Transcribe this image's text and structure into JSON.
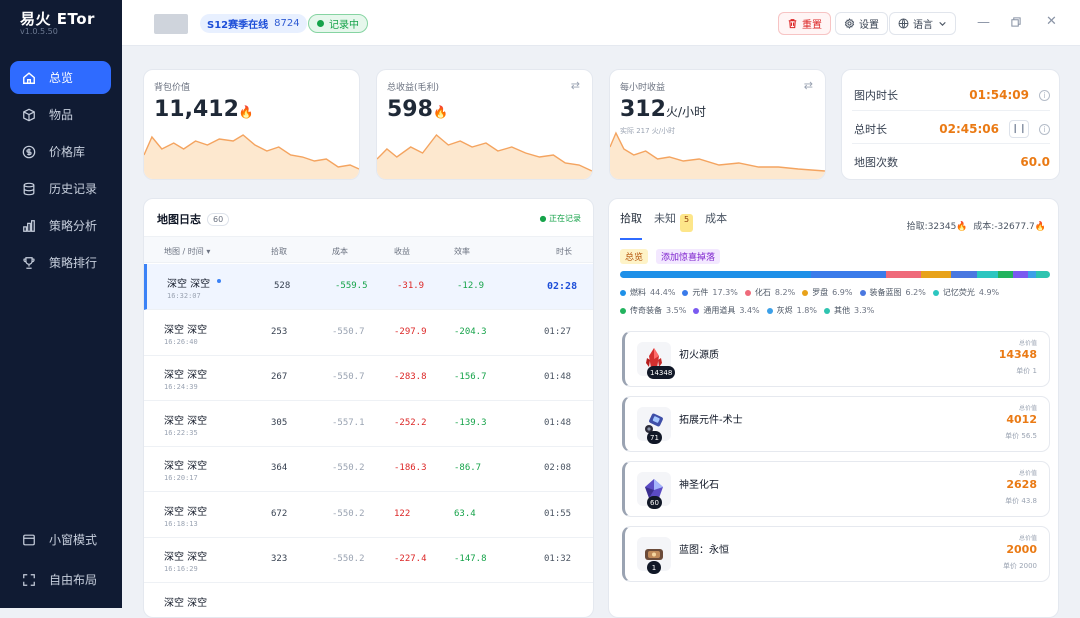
{
  "app": {
    "title": "易火 ETor",
    "version": "v1.0.5.50"
  },
  "nav": [
    {
      "label": "总览",
      "icon": "home-icon",
      "active": true
    },
    {
      "label": "物品",
      "icon": "box-icon"
    },
    {
      "label": "价格库",
      "icon": "dollar-icon"
    },
    {
      "label": "历史记录",
      "icon": "database-icon"
    },
    {
      "label": "策略分析",
      "icon": "bar-chart-icon"
    },
    {
      "label": "策略排行",
      "icon": "trophy-icon"
    }
  ],
  "nav_bottom": [
    {
      "label": "小窗模式",
      "icon": "window-icon"
    },
    {
      "label": "自由布局",
      "icon": "expand-icon"
    }
  ],
  "topbar": {
    "season_label": "S12赛季在线",
    "season_count": "8724",
    "recording": "记录中",
    "reset": "重置",
    "settings": "设置",
    "language": "语言"
  },
  "cards": {
    "bag": {
      "title": "背包价值",
      "value": "11,412"
    },
    "profit": {
      "title": "总收益(毛利)",
      "value": "598"
    },
    "hourly": {
      "title": "每小时收益",
      "value": "312",
      "unit": "火/小时",
      "actual": "实际 217 火/小时"
    }
  },
  "timers": [
    {
      "label": "图内时长",
      "value": "01:54:09"
    },
    {
      "label": "总时长",
      "value": "02:45:06"
    },
    {
      "label": "地图次数",
      "value": "60.0"
    }
  ],
  "log": {
    "title": "地图日志",
    "count": "60",
    "status": "正在记录",
    "headers": [
      "地图 / 时间",
      "拾取",
      "成本",
      "收益",
      "效率",
      "时长"
    ],
    "rows": [
      {
        "name": "深空 深空",
        "time": "16:32:07",
        "pick": "528",
        "cost": "-559.5",
        "profit": "-31.9",
        "eff": "-12.9",
        "dur": "02:28"
      },
      {
        "name": "深空 深空",
        "time": "16:26:40",
        "pick": "253",
        "cost": "-550.7",
        "profit": "-297.9",
        "eff": "-204.3",
        "dur": "01:27"
      },
      {
        "name": "深空 深空",
        "time": "16:24:39",
        "pick": "267",
        "cost": "-550.7",
        "profit": "-283.8",
        "eff": "-156.7",
        "dur": "01:48"
      },
      {
        "name": "深空 深空",
        "time": "16:22:35",
        "pick": "305",
        "cost": "-557.1",
        "profit": "-252.2",
        "eff": "-139.3",
        "dur": "01:48"
      },
      {
        "name": "深空 深空",
        "time": "16:20:17",
        "pick": "364",
        "cost": "-550.2",
        "profit": "-186.3",
        "eff": "-86.7",
        "dur": "02:08"
      },
      {
        "name": "深空 深空",
        "time": "16:18:13",
        "pick": "672",
        "cost": "-550.2",
        "profit": "122",
        "eff": "63.4",
        "dur": "01:55"
      },
      {
        "name": "深空 深空",
        "time": "16:16:29",
        "pick": "323",
        "cost": "-550.2",
        "profit": "-227.4",
        "eff": "-147.8",
        "dur": "01:32"
      },
      {
        "name": "深空 深空",
        "time": "",
        "pick": "",
        "cost": "",
        "profit": "",
        "eff": "",
        "dur": ""
      }
    ]
  },
  "loot": {
    "tabs": [
      "拾取",
      "未知",
      "成本"
    ],
    "unknown_badge": "5",
    "pickup_total": "拾取:32345",
    "cost_total": "成本:-32677.7",
    "chips": [
      "总览",
      "添加惊喜掉落"
    ],
    "categories": [
      {
        "name": "燃料",
        "pct": "44.4%",
        "color": "#1e90e8"
      },
      {
        "name": "元件",
        "pct": "17.3%",
        "color": "#3a7bea"
      },
      {
        "name": "化石",
        "pct": "8.2%",
        "color": "#ef6a7a"
      },
      {
        "name": "罗盘",
        "pct": "6.9%",
        "color": "#e8a21a"
      },
      {
        "name": "装备蓝图",
        "pct": "6.2%",
        "color": "#4a78e0"
      },
      {
        "name": "记忆荧光",
        "pct": "4.9%",
        "color": "#2cc6c0"
      },
      {
        "name": "传奇装备",
        "pct": "3.5%",
        "color": "#22b35e"
      },
      {
        "name": "通用道具",
        "pct": "3.4%",
        "color": "#7a5af0"
      },
      {
        "name": "灰烬",
        "pct": "1.8%",
        "color": "#3ca0e8"
      },
      {
        "name": "其他",
        "pct": "3.3%",
        "color": "#2ec4b0"
      }
    ],
    "total_label": "总价值",
    "unit_label": "单价",
    "items": [
      {
        "name": "初火源质",
        "qty": "14348",
        "total": "14348",
        "unit": "1",
        "icon": "red-crystal-icon"
      },
      {
        "name": "拓展元件-术士",
        "qty": "71",
        "total": "4012",
        "unit": "56.5",
        "icon": "component-icon"
      },
      {
        "name": "神圣化石",
        "qty": "60",
        "total": "2628",
        "unit": "43.8",
        "icon": "fossil-icon"
      },
      {
        "name": "蓝图：永恒",
        "qty": "1",
        "total": "2000",
        "unit": "2000",
        "icon": "blueprint-icon"
      }
    ]
  }
}
